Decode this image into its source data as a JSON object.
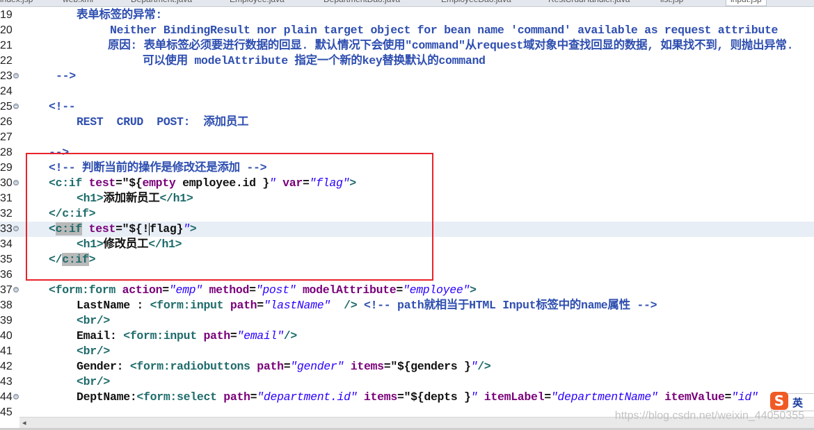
{
  "tabs": [
    {
      "label": "index.jsp",
      "active": false
    },
    {
      "label": "web.xml",
      "active": false
    },
    {
      "label": "Department.java",
      "active": false
    },
    {
      "label": "Employee.java",
      "active": false
    },
    {
      "label": "DepartmentDao.java",
      "active": false
    },
    {
      "label": "EmployeeDao.java",
      "active": false
    },
    {
      "label": "RestCrudHandler.java",
      "active": false
    },
    {
      "label": "list.jsp",
      "active": false
    },
    {
      "label": "input.jsp",
      "active": true
    }
  ],
  "colors": {
    "tag": "#1f6b6b",
    "attribute": "#7a007a",
    "value": "#2a00ff",
    "comment": "#2f4fb0",
    "highlight_box": "#e8232a",
    "current_line": "#e8eef6"
  },
  "current_line": 33,
  "lines": [
    {
      "n": "19",
      "fold": false,
      "indent": 110,
      "tokens": [
        [
          "cm",
          "表单标签的异常:"
        ]
      ]
    },
    {
      "n": "20",
      "fold": false,
      "indent": 158,
      "tokens": [
        [
          "cm",
          "Neither BindingResult nor plain target object for bean name 'command' available as request attribute"
        ]
      ]
    },
    {
      "n": "21",
      "fold": false,
      "indent": 155,
      "tokens": [
        [
          "cm",
          "原因: 表单标签必须要进行数据的回显. 默认情况下会使用\"command\"从request域对象中查找回显的数据, 如果找不到, 则抛出异常."
        ]
      ]
    },
    {
      "n": "22",
      "fold": false,
      "indent": 205,
      "tokens": [
        [
          "cm",
          "可以使用 modelAttribute 指定一个新的key替换默认的command"
        ]
      ]
    },
    {
      "n": "23",
      "fold": true,
      "indent": 80,
      "tokens": [
        [
          "cm",
          "-->"
        ]
      ]
    },
    {
      "n": "24",
      "fold": false,
      "indent": 70,
      "tokens": []
    },
    {
      "n": "25",
      "fold": true,
      "indent": 70,
      "tokens": [
        [
          "cm",
          "<!--"
        ]
      ]
    },
    {
      "n": "26",
      "fold": false,
      "indent": 110,
      "tokens": [
        [
          "cm",
          "REST  CRUD  POST:  添加员工"
        ]
      ]
    },
    {
      "n": "27",
      "fold": false,
      "indent": 70,
      "tokens": []
    },
    {
      "n": "28",
      "fold": false,
      "indent": 70,
      "tokens": [
        [
          "cm",
          "-->"
        ]
      ]
    },
    {
      "n": "29",
      "fold": false,
      "indent": 70,
      "tokens": [
        [
          "cm",
          "<!-- 判断当前的操作是修改还是添加 -->"
        ]
      ]
    },
    {
      "n": "30",
      "fold": true,
      "indent": 70,
      "tokens": [
        [
          "tg",
          "<c:if "
        ],
        [
          "at",
          "test"
        ],
        [
          "tx",
          "="
        ],
        [
          "tx",
          "\"${"
        ],
        [
          "ek",
          "empty"
        ],
        [
          "tx",
          " employee.id }"
        ],
        [
          "v",
          "\""
        ],
        [
          "tx",
          " "
        ],
        [
          "at",
          "var"
        ],
        [
          "tx",
          "="
        ],
        [
          "v",
          "\"flag\""
        ],
        [
          "tg",
          ">"
        ]
      ]
    },
    {
      "n": "31",
      "fold": false,
      "indent": 110,
      "tokens": [
        [
          "tg",
          "<h1>"
        ],
        [
          "tx",
          "添加新员工"
        ],
        [
          "tg",
          "</h1>"
        ]
      ]
    },
    {
      "n": "32",
      "fold": false,
      "indent": 70,
      "tokens": [
        [
          "tg",
          "</c:if>"
        ]
      ]
    },
    {
      "n": "33",
      "fold": true,
      "indent": 70,
      "tokens": [
        [
          "tg",
          "<"
        ],
        [
          "tg hl",
          "c:if"
        ],
        [
          "tx",
          " "
        ],
        [
          "at",
          "test"
        ],
        [
          "tx",
          "="
        ],
        [
          "tx",
          "\"${!"
        ],
        [
          "caret",
          ""
        ],
        [
          "tx",
          "flag}"
        ],
        [
          "v",
          "\""
        ],
        [
          "tg",
          ">"
        ]
      ]
    },
    {
      "n": "34",
      "fold": false,
      "indent": 110,
      "tokens": [
        [
          "tg",
          "<h1>"
        ],
        [
          "tx",
          "修改员工"
        ],
        [
          "tg",
          "</h1>"
        ]
      ]
    },
    {
      "n": "35",
      "fold": false,
      "indent": 70,
      "tokens": [
        [
          "tg",
          "</"
        ],
        [
          "tg hl",
          "c:if"
        ],
        [
          "tg",
          ">"
        ]
      ]
    },
    {
      "n": "36",
      "fold": false,
      "indent": 70,
      "tokens": []
    },
    {
      "n": "37",
      "fold": true,
      "indent": 70,
      "tokens": [
        [
          "tg",
          "<form:form "
        ],
        [
          "at",
          "action"
        ],
        [
          "tx",
          "="
        ],
        [
          "v",
          "\"emp\""
        ],
        [
          "tx",
          " "
        ],
        [
          "at",
          "method"
        ],
        [
          "tx",
          "="
        ],
        [
          "v",
          "\"post\""
        ],
        [
          "tx",
          " "
        ],
        [
          "at",
          "modelAttribute"
        ],
        [
          "tx",
          "="
        ],
        [
          "v",
          "\"employee\""
        ],
        [
          "tg",
          ">"
        ]
      ]
    },
    {
      "n": "38",
      "fold": false,
      "indent": 110,
      "tokens": [
        [
          "tx",
          "LastName : "
        ],
        [
          "tg",
          "<form:input "
        ],
        [
          "at",
          "path"
        ],
        [
          "tx",
          "="
        ],
        [
          "v",
          "\"lastName\""
        ],
        [
          "tx",
          "  "
        ],
        [
          "tg",
          "/>"
        ],
        [
          "tx",
          " "
        ],
        [
          "cm",
          "<!-- path就相当于HTML Input标签中的name属性 -->"
        ]
      ]
    },
    {
      "n": "39",
      "fold": false,
      "indent": 110,
      "tokens": [
        [
          "tg",
          "<br/>"
        ]
      ]
    },
    {
      "n": "40",
      "fold": false,
      "indent": 110,
      "tokens": [
        [
          "tx",
          "Email: "
        ],
        [
          "tg",
          "<form:input "
        ],
        [
          "at",
          "path"
        ],
        [
          "tx",
          "="
        ],
        [
          "v",
          "\"email\""
        ],
        [
          "tg",
          "/>"
        ]
      ]
    },
    {
      "n": "41",
      "fold": false,
      "indent": 110,
      "tokens": [
        [
          "tg",
          "<br/>"
        ]
      ]
    },
    {
      "n": "42",
      "fold": false,
      "indent": 110,
      "tokens": [
        [
          "tx",
          "Gender: "
        ],
        [
          "tg",
          "<form:radiobuttons "
        ],
        [
          "at",
          "path"
        ],
        [
          "tx",
          "="
        ],
        [
          "v",
          "\"gender\""
        ],
        [
          "tx",
          " "
        ],
        [
          "at",
          "items"
        ],
        [
          "tx",
          "="
        ],
        [
          "tx",
          "\"${genders }"
        ],
        [
          "v",
          "\""
        ],
        [
          "tg",
          "/>"
        ]
      ]
    },
    {
      "n": "43",
      "fold": false,
      "indent": 110,
      "tokens": [
        [
          "tg",
          "<br/>"
        ]
      ]
    },
    {
      "n": "44",
      "fold": true,
      "indent": 110,
      "tokens": [
        [
          "tx",
          "DeptName:"
        ],
        [
          "tg",
          "<form:select "
        ],
        [
          "at",
          "path"
        ],
        [
          "tx",
          "="
        ],
        [
          "v",
          "\"department.id\""
        ],
        [
          "tx",
          " "
        ],
        [
          "at",
          "items"
        ],
        [
          "tx",
          "="
        ],
        [
          "tx",
          "\"${depts }"
        ],
        [
          "v",
          "\""
        ],
        [
          "tx",
          " "
        ],
        [
          "at",
          "itemLabel"
        ],
        [
          "tx",
          "="
        ],
        [
          "v",
          "\"departmentName\""
        ],
        [
          "tx",
          " "
        ],
        [
          "at",
          "itemValue"
        ],
        [
          "tx",
          "="
        ],
        [
          "v",
          "\"id\""
        ]
      ]
    },
    {
      "n": "45",
      "fold": false,
      "indent": 110,
      "tokens": []
    }
  ],
  "ime": {
    "logo": "S",
    "lang": "英"
  },
  "watermark": "https://blog.csdn.net/weixin_44050355",
  "scrollbar": {
    "left_arrow": "◂"
  }
}
